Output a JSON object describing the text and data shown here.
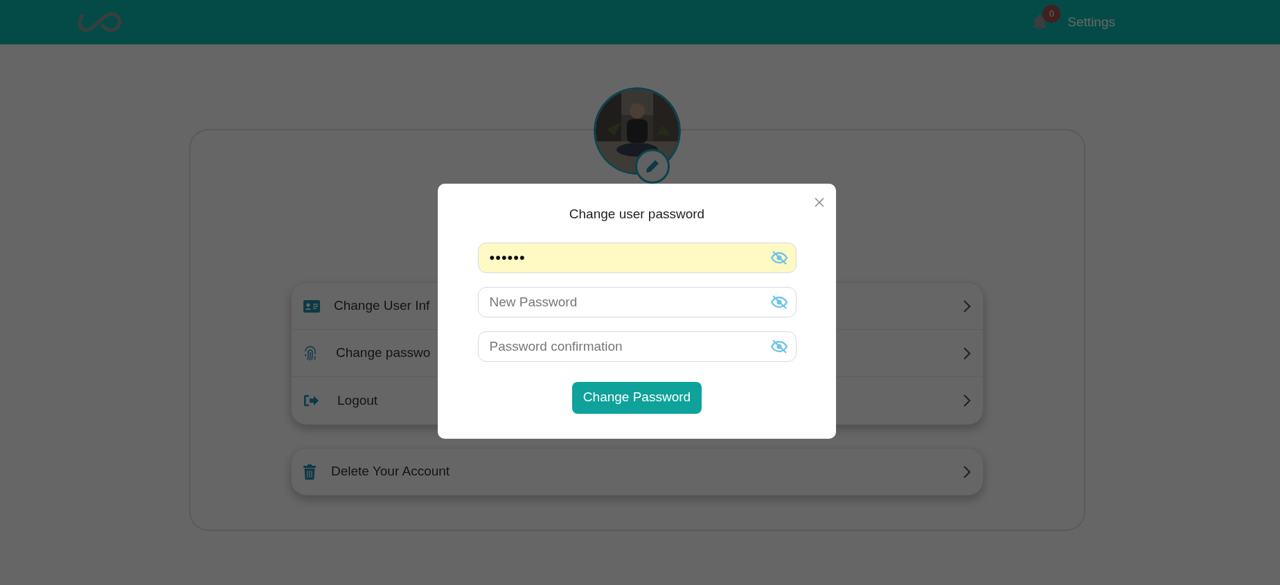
{
  "header": {
    "notifications": "0",
    "settings": "Settings"
  },
  "menu": [
    {
      "kind": "user-info",
      "label": "Change User Inf"
    },
    {
      "kind": "password",
      "label": "Change passwo"
    },
    {
      "kind": "logout",
      "label": "Logout"
    }
  ],
  "danger": [
    {
      "kind": "delete",
      "label": "Delete Your Account"
    }
  ],
  "modal": {
    "title": "Change user password",
    "fields": [
      {
        "value": "••••••",
        "autofilled": true
      },
      {
        "placeholder": "New Password",
        "autofilled": false
      },
      {
        "placeholder": "Password confirmation",
        "autofilled": false
      }
    ],
    "button": "Change Password"
  }
}
